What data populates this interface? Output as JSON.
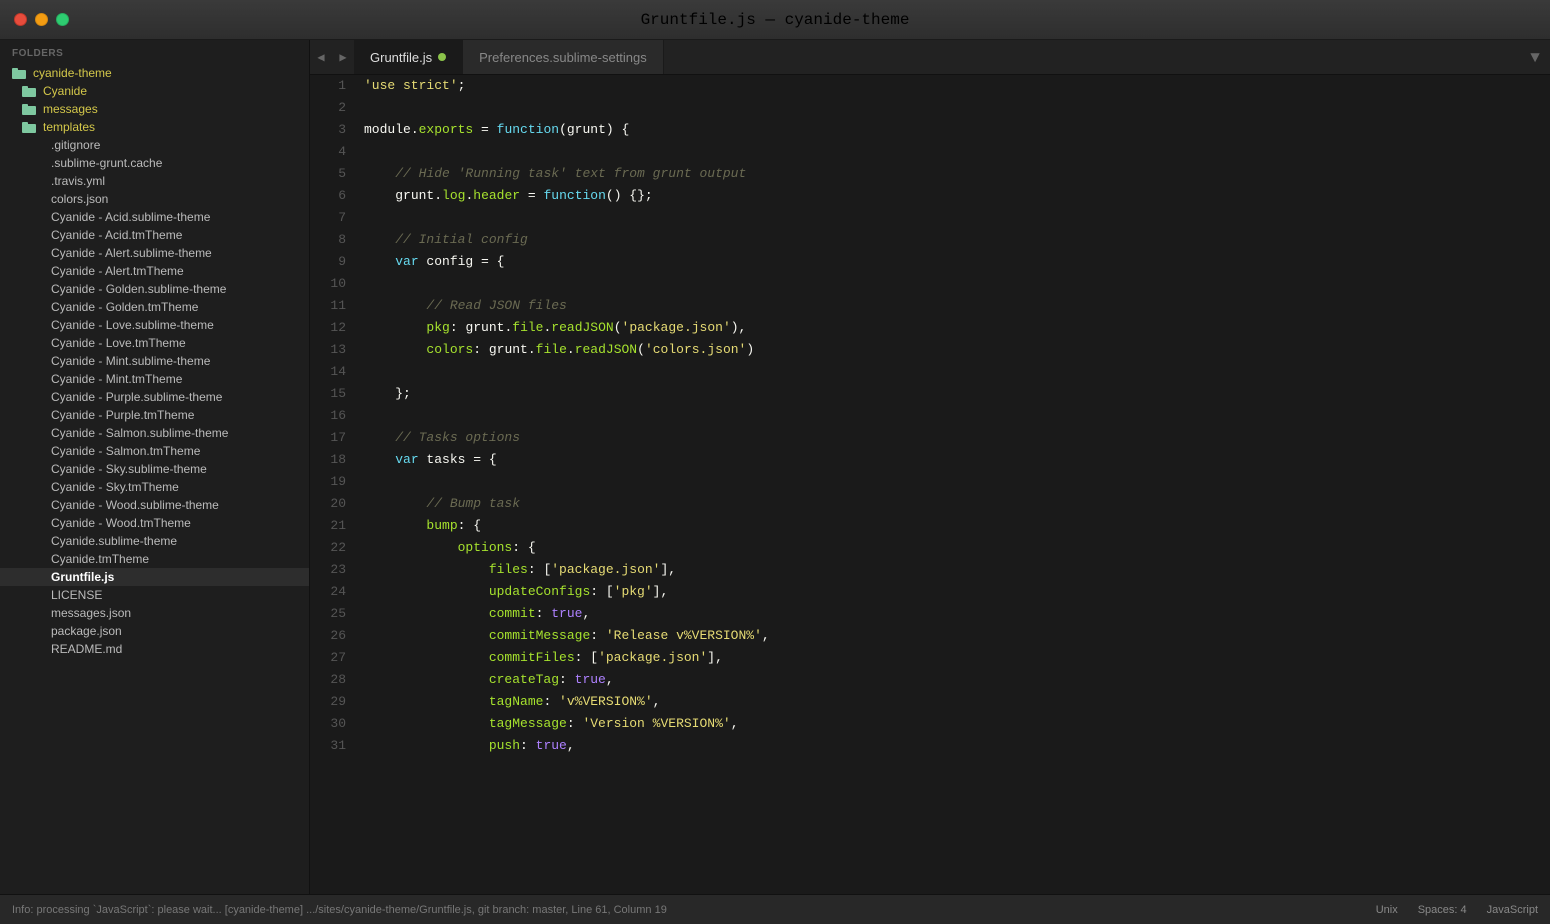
{
  "titlebar": {
    "title": "Gruntfile.js — cyanide-theme"
  },
  "tabs": [
    {
      "id": "tab-gruntfile",
      "label": "Gruntfile.js",
      "active": true,
      "modified": true
    },
    {
      "id": "tab-preferences",
      "label": "Preferences.sublime-settings",
      "active": false,
      "modified": false
    }
  ],
  "folders_header": "FOLDERS",
  "sidebar": {
    "items": [
      {
        "id": "cyanide-theme",
        "label": "cyanide-theme",
        "type": "root-folder",
        "indent": 0
      },
      {
        "id": "Cyanide",
        "label": "Cyanide",
        "type": "folder",
        "indent": 1
      },
      {
        "id": "messages",
        "label": "messages",
        "type": "folder",
        "indent": 1
      },
      {
        "id": "templates",
        "label": "templates",
        "type": "folder",
        "indent": 1
      },
      {
        "id": "gitignore",
        "label": ".gitignore",
        "type": "file",
        "indent": 2
      },
      {
        "id": "sublime-grunt-cache",
        "label": ".sublime-grunt.cache",
        "type": "file",
        "indent": 2
      },
      {
        "id": "travis-yml",
        "label": ".travis.yml",
        "type": "file",
        "indent": 2
      },
      {
        "id": "colors-json",
        "label": "colors.json",
        "type": "file",
        "indent": 2
      },
      {
        "id": "cyanide-acid-sublime",
        "label": "Cyanide - Acid.sublime-theme",
        "type": "file",
        "indent": 2
      },
      {
        "id": "cyanide-acid-tm",
        "label": "Cyanide - Acid.tmTheme",
        "type": "file",
        "indent": 2
      },
      {
        "id": "cyanide-alert-sublime",
        "label": "Cyanide - Alert.sublime-theme",
        "type": "file",
        "indent": 2
      },
      {
        "id": "cyanide-alert-tm",
        "label": "Cyanide - Alert.tmTheme",
        "type": "file",
        "indent": 2
      },
      {
        "id": "cyanide-golden-sublime",
        "label": "Cyanide - Golden.sublime-theme",
        "type": "file",
        "indent": 2
      },
      {
        "id": "cyanide-golden-tm",
        "label": "Cyanide - Golden.tmTheme",
        "type": "file",
        "indent": 2
      },
      {
        "id": "cyanide-love-sublime",
        "label": "Cyanide - Love.sublime-theme",
        "type": "file",
        "indent": 2
      },
      {
        "id": "cyanide-love-tm",
        "label": "Cyanide - Love.tmTheme",
        "type": "file",
        "indent": 2
      },
      {
        "id": "cyanide-mint-sublime",
        "label": "Cyanide - Mint.sublime-theme",
        "type": "file",
        "indent": 2
      },
      {
        "id": "cyanide-mint-tm",
        "label": "Cyanide - Mint.tmTheme",
        "type": "file",
        "indent": 2
      },
      {
        "id": "cyanide-purple-sublime",
        "label": "Cyanide - Purple.sublime-theme",
        "type": "file",
        "indent": 2
      },
      {
        "id": "cyanide-purple-tm",
        "label": "Cyanide - Purple.tmTheme",
        "type": "file",
        "indent": 2
      },
      {
        "id": "cyanide-salmon-sublime",
        "label": "Cyanide - Salmon.sublime-theme",
        "type": "file",
        "indent": 2
      },
      {
        "id": "cyanide-salmon-tm",
        "label": "Cyanide - Salmon.tmTheme",
        "type": "file",
        "indent": 2
      },
      {
        "id": "cyanide-sky-sublime",
        "label": "Cyanide - Sky.sublime-theme",
        "type": "file",
        "indent": 2
      },
      {
        "id": "cyanide-sky-tm",
        "label": "Cyanide - Sky.tmTheme",
        "type": "file",
        "indent": 2
      },
      {
        "id": "cyanide-wood-sublime",
        "label": "Cyanide - Wood.sublime-theme",
        "type": "file",
        "indent": 2
      },
      {
        "id": "cyanide-wood-tm",
        "label": "Cyanide - Wood.tmTheme",
        "type": "file",
        "indent": 2
      },
      {
        "id": "cyanide-sublime",
        "label": "Cyanide.sublime-theme",
        "type": "file",
        "indent": 2
      },
      {
        "id": "cyanide-tm",
        "label": "Cyanide.tmTheme",
        "type": "file",
        "indent": 2
      },
      {
        "id": "gruntfile-js",
        "label": "Gruntfile.js",
        "type": "file",
        "indent": 2,
        "active": true
      },
      {
        "id": "license",
        "label": "LICENSE",
        "type": "file",
        "indent": 2
      },
      {
        "id": "messages-json",
        "label": "messages.json",
        "type": "file",
        "indent": 2
      },
      {
        "id": "package-json",
        "label": "package.json",
        "type": "file",
        "indent": 2
      },
      {
        "id": "readme-md",
        "label": "README.md",
        "type": "file",
        "indent": 2
      }
    ]
  },
  "code_lines": [
    {
      "num": 1,
      "html": "<span class='s-string'>'use strict'</span><span class='s-punct'>;</span>"
    },
    {
      "num": 2,
      "html": ""
    },
    {
      "num": 3,
      "html": "<span class='s-var'>module</span><span class='s-punct'>.</span><span class='s-prop'>exports</span><span class='s-punct'> = </span><span class='s-keyword'>function</span><span class='s-punct'>(</span><span class='s-var'>grunt</span><span class='s-punct'>) {</span>"
    },
    {
      "num": 4,
      "html": ""
    },
    {
      "num": 5,
      "html": "    <span class='s-comment'>// Hide 'Running task' text from grunt output</span>"
    },
    {
      "num": 6,
      "html": "    <span class='s-var'>grunt</span><span class='s-punct'>.</span><span class='s-prop'>log</span><span class='s-punct'>.</span><span class='s-prop'>header</span><span class='s-punct'> = </span><span class='s-keyword'>function</span><span class='s-punct'>() {};</span>"
    },
    {
      "num": 7,
      "html": ""
    },
    {
      "num": 8,
      "html": "    <span class='s-comment'>// Initial config</span>"
    },
    {
      "num": 9,
      "html": "    <span class='s-keyword'>var</span><span class='s-plain'> config = {</span>"
    },
    {
      "num": 10,
      "html": ""
    },
    {
      "num": 11,
      "html": "        <span class='s-comment'>// Read JSON files</span>"
    },
    {
      "num": 12,
      "html": "        <span class='s-prop'>pkg</span><span class='s-punct'>: </span><span class='s-var'>grunt</span><span class='s-punct'>.</span><span class='s-prop'>file</span><span class='s-punct'>.</span><span class='s-fn'>readJSON</span><span class='s-punct'>(</span><span class='s-string'>'package.json'</span><span class='s-punct'>),</span>"
    },
    {
      "num": 13,
      "html": "        <span class='s-prop'>colors</span><span class='s-punct'>: </span><span class='s-var'>grunt</span><span class='s-punct'>.</span><span class='s-prop'>file</span><span class='s-punct'>.</span><span class='s-fn'>readJSON</span><span class='s-punct'>(</span><span class='s-string'>'colors.json'</span><span class='s-punct'>)</span>"
    },
    {
      "num": 14,
      "html": ""
    },
    {
      "num": 15,
      "html": "    <span class='s-punct'>};</span>"
    },
    {
      "num": 16,
      "html": ""
    },
    {
      "num": 17,
      "html": "    <span class='s-comment'>// Tasks options</span>"
    },
    {
      "num": 18,
      "html": "    <span class='s-keyword'>var</span><span class='s-plain'> tasks = {</span>"
    },
    {
      "num": 19,
      "html": ""
    },
    {
      "num": 20,
      "html": "        <span class='s-comment'>// Bump task</span>"
    },
    {
      "num": 21,
      "html": "        <span class='s-prop'>bump</span><span class='s-punct'>: {</span>"
    },
    {
      "num": 22,
      "html": "            <span class='s-prop'>options</span><span class='s-punct'>: {</span>"
    },
    {
      "num": 23,
      "html": "                <span class='s-prop'>files</span><span class='s-punct'>: [</span><span class='s-string'>'package.json'</span><span class='s-punct'>],</span>"
    },
    {
      "num": 24,
      "html": "                <span class='s-prop'>updateConfigs</span><span class='s-punct'>: [</span><span class='s-string'>'pkg'</span><span class='s-punct'>],</span>"
    },
    {
      "num": 25,
      "html": "                <span class='s-prop'>commit</span><span class='s-punct'>: </span><span class='s-bool'>true</span><span class='s-punct'>,</span>"
    },
    {
      "num": 26,
      "html": "                <span class='s-prop'>commitMessage</span><span class='s-punct'>: </span><span class='s-string'>'Release v%VERSION%'</span><span class='s-punct'>,</span>"
    },
    {
      "num": 27,
      "html": "                <span class='s-prop'>commitFiles</span><span class='s-punct'>: [</span><span class='s-string'>'package.json'</span><span class='s-punct'>],</span>"
    },
    {
      "num": 28,
      "html": "                <span class='s-prop'>createTag</span><span class='s-punct'>: </span><span class='s-bool'>true</span><span class='s-punct'>,</span>"
    },
    {
      "num": 29,
      "html": "                <span class='s-prop'>tagName</span><span class='s-punct'>: </span><span class='s-string'>'v%VERSION%'</span><span class='s-punct'>,</span>"
    },
    {
      "num": 30,
      "html": "                <span class='s-prop'>tagMessage</span><span class='s-punct'>: </span><span class='s-string'>'Version %VERSION%'</span><span class='s-punct'>,</span>"
    },
    {
      "num": 31,
      "html": "                <span class='s-prop'>push</span><span class='s-punct'>: </span><span class='s-bool'>true</span><span class='s-punct'>,</span>"
    }
  ],
  "statusbar": {
    "left": "Info: processing `JavaScript`: please wait...  [cyanide-theme] .../sites/cyanide-theme/Gruntfile.js, git branch: master, Line 61, Column 19",
    "right_unix": "Unix",
    "right_spaces": "Spaces: 4",
    "right_lang": "JavaScript"
  }
}
